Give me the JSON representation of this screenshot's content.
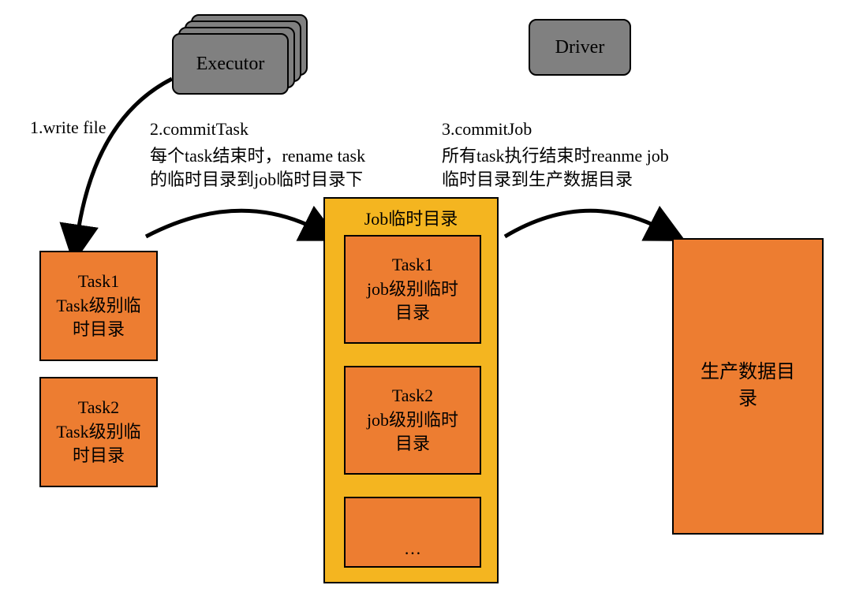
{
  "nodes": {
    "executor": "Executor",
    "driver": "Driver",
    "task1_box": "Task1\nTask级别临\n时目录",
    "task2_box": "Task2\nTask级别临\n时目录",
    "job_container_title": "Job临时目录",
    "job_task1": "Task1\njob级别临时\n目录",
    "job_task2": "Task2\njob级别临时\n目录",
    "ellipsis": "…",
    "prod_dir": "生产数据目\n录"
  },
  "steps": {
    "s1": "1.write file",
    "s2_title": "2.commitTask",
    "s2_desc1": "每个task结束时，rename task",
    "s2_desc2": "的临时目录到job临时目录下",
    "s3_title": "3.commitJob",
    "s3_desc1": "所有task执行结束时reanme job",
    "s3_desc2": "临时目录到生产数据目录"
  }
}
